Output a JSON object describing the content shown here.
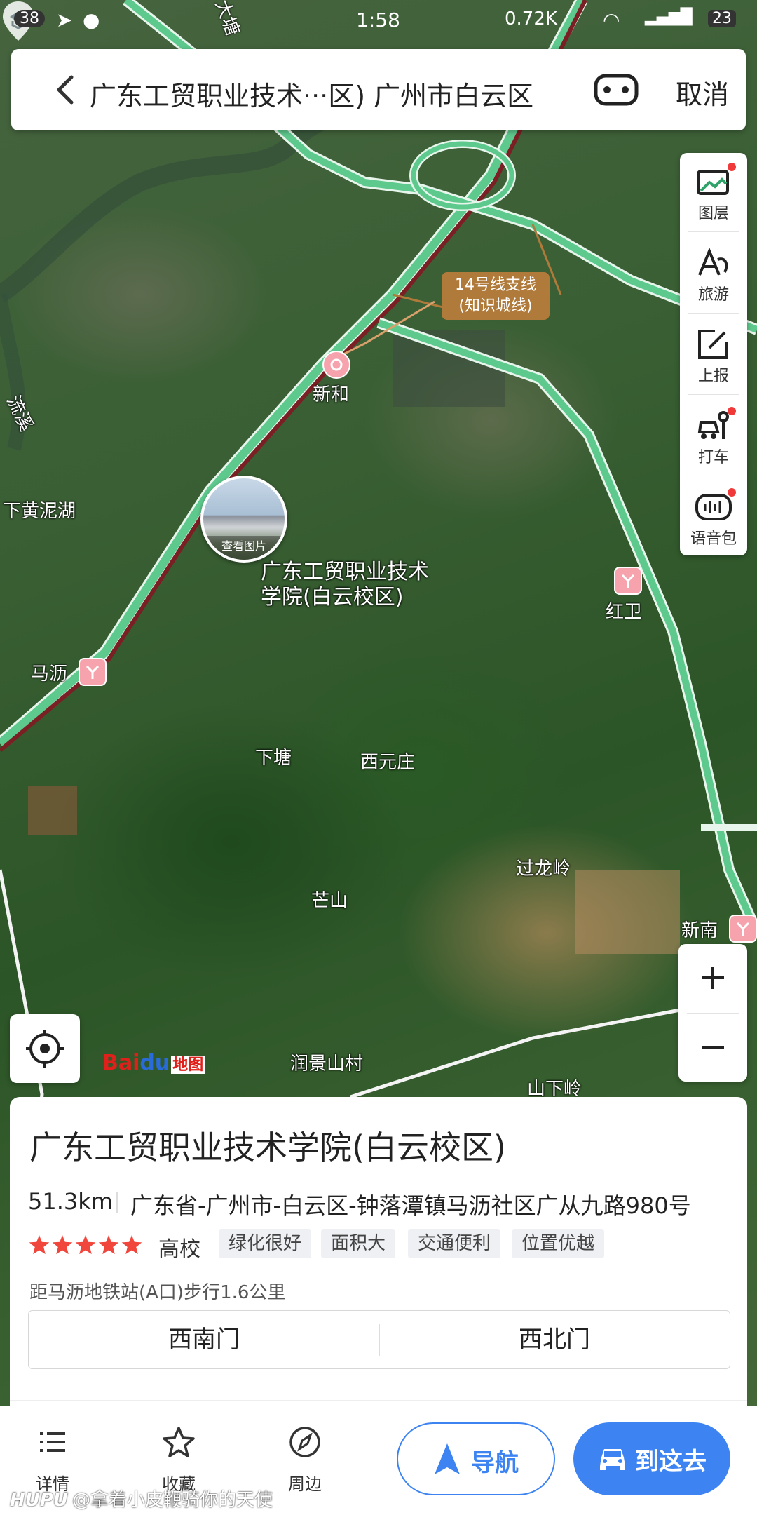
{
  "status_bar": {
    "notif_count": "38",
    "time": "1:58",
    "net_speed": "0.72K",
    "battery": "23"
  },
  "search": {
    "query": "广东工贸职业技术···区) 广州市白云区",
    "cancel_label": "取消"
  },
  "toolbar": {
    "items": [
      {
        "label": "图层",
        "icon": "layers-icon",
        "dot": true
      },
      {
        "label": "旅游",
        "icon": "travel-icon",
        "dot": false
      },
      {
        "label": "上报",
        "icon": "report-icon",
        "dot": false
      },
      {
        "label": "打车",
        "icon": "taxi-icon",
        "dot": true
      },
      {
        "label": "语音包",
        "icon": "voice-pack-icon",
        "dot": true
      }
    ]
  },
  "map": {
    "labels": {
      "xinhe": "新和",
      "xiahuangnihu": "下黄泥湖",
      "mali": "马沥",
      "hongwei": "红卫",
      "xiatang": "下塘",
      "xiyuanzhuang": "西元庄",
      "guolongling": "过龙岭",
      "mangshan": "芒山",
      "xinnan": "新南",
      "runjingshancun": "润景山村",
      "shanxialing": "山下岭",
      "dachang": "大塘",
      "liuxi": "流溪"
    },
    "line_tag": {
      "line1": "14号线支线",
      "line2": "(知识城线)"
    },
    "photo_caption": "查看图片",
    "poi_line1": "广东工贸职业技术",
    "poi_line2": "学院(白云校区)",
    "logo": {
      "bai": "Bai",
      "du": "du",
      "sub": "地图"
    }
  },
  "place": {
    "name": "广东工贸职业技术学院(白云校区)",
    "distance": "51.3km",
    "address": "广东省-广州市-白云区-钟落潭镇马沥社区广从九路980号",
    "rating": 5,
    "category": "高校",
    "tags": [
      "绿化很好",
      "面积大",
      "交通便利",
      "位置优越"
    ],
    "transit": "距马沥地铁站(A口)步行1.6公里",
    "gates": [
      "西南门",
      "西北门"
    ]
  },
  "bottom_nav": {
    "details": "详情",
    "favorite": "收藏",
    "nearby": "周边",
    "navigate": "导航",
    "go_here": "到这去"
  },
  "watermark": {
    "brand": "HUPU",
    "text": "@拿着小皮鞭骑你的天使"
  },
  "colors": {
    "accent": "#3d84f2",
    "star": "#f0463c",
    "road": "#6bd49a",
    "road_red": "#7a1f24",
    "metro": "#f7a3ad"
  }
}
